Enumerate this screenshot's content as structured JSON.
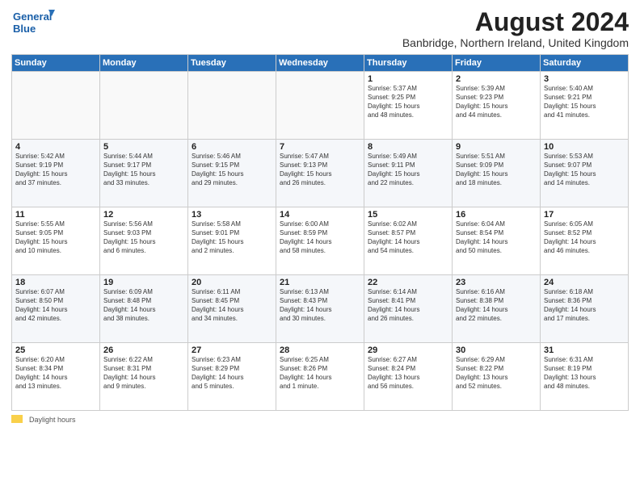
{
  "logo": {
    "line1": "General",
    "line2": "Blue"
  },
  "title": "August 2024",
  "subtitle": "Banbridge, Northern Ireland, United Kingdom",
  "days_of_week": [
    "Sunday",
    "Monday",
    "Tuesday",
    "Wednesday",
    "Thursday",
    "Friday",
    "Saturday"
  ],
  "footer": {
    "daylight_label": "Daylight hours"
  },
  "weeks": [
    [
      {
        "day": "",
        "info": ""
      },
      {
        "day": "",
        "info": ""
      },
      {
        "day": "",
        "info": ""
      },
      {
        "day": "",
        "info": ""
      },
      {
        "day": "1",
        "info": "Sunrise: 5:37 AM\nSunset: 9:25 PM\nDaylight: 15 hours\nand 48 minutes."
      },
      {
        "day": "2",
        "info": "Sunrise: 5:39 AM\nSunset: 9:23 PM\nDaylight: 15 hours\nand 44 minutes."
      },
      {
        "day": "3",
        "info": "Sunrise: 5:40 AM\nSunset: 9:21 PM\nDaylight: 15 hours\nand 41 minutes."
      }
    ],
    [
      {
        "day": "4",
        "info": "Sunrise: 5:42 AM\nSunset: 9:19 PM\nDaylight: 15 hours\nand 37 minutes."
      },
      {
        "day": "5",
        "info": "Sunrise: 5:44 AM\nSunset: 9:17 PM\nDaylight: 15 hours\nand 33 minutes."
      },
      {
        "day": "6",
        "info": "Sunrise: 5:46 AM\nSunset: 9:15 PM\nDaylight: 15 hours\nand 29 minutes."
      },
      {
        "day": "7",
        "info": "Sunrise: 5:47 AM\nSunset: 9:13 PM\nDaylight: 15 hours\nand 26 minutes."
      },
      {
        "day": "8",
        "info": "Sunrise: 5:49 AM\nSunset: 9:11 PM\nDaylight: 15 hours\nand 22 minutes."
      },
      {
        "day": "9",
        "info": "Sunrise: 5:51 AM\nSunset: 9:09 PM\nDaylight: 15 hours\nand 18 minutes."
      },
      {
        "day": "10",
        "info": "Sunrise: 5:53 AM\nSunset: 9:07 PM\nDaylight: 15 hours\nand 14 minutes."
      }
    ],
    [
      {
        "day": "11",
        "info": "Sunrise: 5:55 AM\nSunset: 9:05 PM\nDaylight: 15 hours\nand 10 minutes."
      },
      {
        "day": "12",
        "info": "Sunrise: 5:56 AM\nSunset: 9:03 PM\nDaylight: 15 hours\nand 6 minutes."
      },
      {
        "day": "13",
        "info": "Sunrise: 5:58 AM\nSunset: 9:01 PM\nDaylight: 15 hours\nand 2 minutes."
      },
      {
        "day": "14",
        "info": "Sunrise: 6:00 AM\nSunset: 8:59 PM\nDaylight: 14 hours\nand 58 minutes."
      },
      {
        "day": "15",
        "info": "Sunrise: 6:02 AM\nSunset: 8:57 PM\nDaylight: 14 hours\nand 54 minutes."
      },
      {
        "day": "16",
        "info": "Sunrise: 6:04 AM\nSunset: 8:54 PM\nDaylight: 14 hours\nand 50 minutes."
      },
      {
        "day": "17",
        "info": "Sunrise: 6:05 AM\nSunset: 8:52 PM\nDaylight: 14 hours\nand 46 minutes."
      }
    ],
    [
      {
        "day": "18",
        "info": "Sunrise: 6:07 AM\nSunset: 8:50 PM\nDaylight: 14 hours\nand 42 minutes."
      },
      {
        "day": "19",
        "info": "Sunrise: 6:09 AM\nSunset: 8:48 PM\nDaylight: 14 hours\nand 38 minutes."
      },
      {
        "day": "20",
        "info": "Sunrise: 6:11 AM\nSunset: 8:45 PM\nDaylight: 14 hours\nand 34 minutes."
      },
      {
        "day": "21",
        "info": "Sunrise: 6:13 AM\nSunset: 8:43 PM\nDaylight: 14 hours\nand 30 minutes."
      },
      {
        "day": "22",
        "info": "Sunrise: 6:14 AM\nSunset: 8:41 PM\nDaylight: 14 hours\nand 26 minutes."
      },
      {
        "day": "23",
        "info": "Sunrise: 6:16 AM\nSunset: 8:38 PM\nDaylight: 14 hours\nand 22 minutes."
      },
      {
        "day": "24",
        "info": "Sunrise: 6:18 AM\nSunset: 8:36 PM\nDaylight: 14 hours\nand 17 minutes."
      }
    ],
    [
      {
        "day": "25",
        "info": "Sunrise: 6:20 AM\nSunset: 8:34 PM\nDaylight: 14 hours\nand 13 minutes."
      },
      {
        "day": "26",
        "info": "Sunrise: 6:22 AM\nSunset: 8:31 PM\nDaylight: 14 hours\nand 9 minutes."
      },
      {
        "day": "27",
        "info": "Sunrise: 6:23 AM\nSunset: 8:29 PM\nDaylight: 14 hours\nand 5 minutes."
      },
      {
        "day": "28",
        "info": "Sunrise: 6:25 AM\nSunset: 8:26 PM\nDaylight: 14 hours\nand 1 minute."
      },
      {
        "day": "29",
        "info": "Sunrise: 6:27 AM\nSunset: 8:24 PM\nDaylight: 13 hours\nand 56 minutes."
      },
      {
        "day": "30",
        "info": "Sunrise: 6:29 AM\nSunset: 8:22 PM\nDaylight: 13 hours\nand 52 minutes."
      },
      {
        "day": "31",
        "info": "Sunrise: 6:31 AM\nSunset: 8:19 PM\nDaylight: 13 hours\nand 48 minutes."
      }
    ]
  ]
}
